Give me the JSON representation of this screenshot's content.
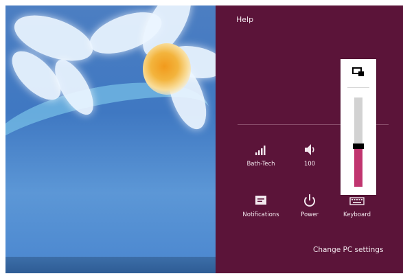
{
  "charms_panel": {
    "title": "Help",
    "change_pc_settings": "Change PC settings",
    "tiles": {
      "network": {
        "label": "Bath-Tech",
        "icon": "network-signal-icon"
      },
      "volume": {
        "label": "100",
        "icon": "speaker-icon"
      },
      "notifications": {
        "label": "Notifications",
        "icon": "notifications-icon"
      },
      "power": {
        "label": "Power",
        "icon": "power-icon"
      },
      "keyboard": {
        "label": "Keyboard",
        "icon": "keyboard-icon"
      }
    },
    "accent_color": "#5b1439"
  },
  "volume_popup": {
    "level": 0.45,
    "icon": "rotation-lock-icon",
    "fill_color": "#c0356f"
  }
}
